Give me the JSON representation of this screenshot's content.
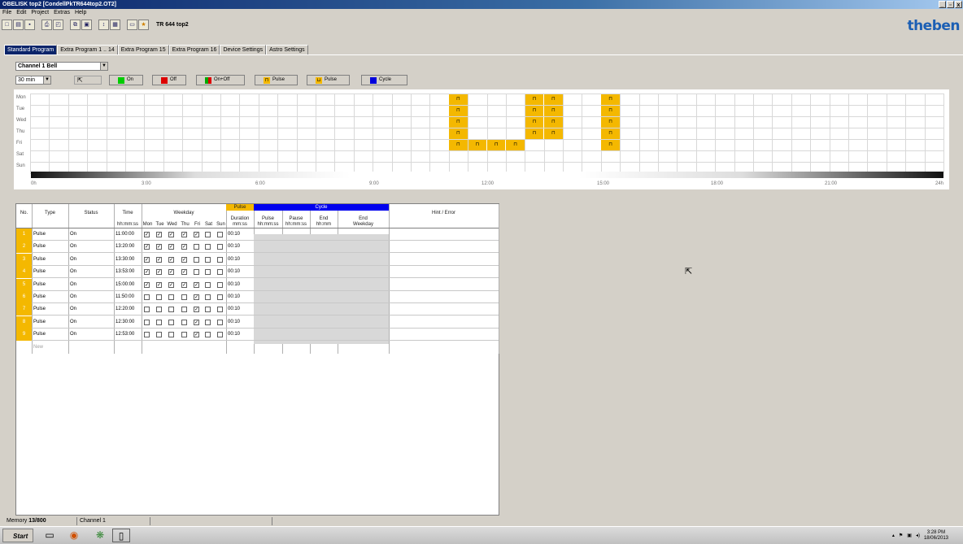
{
  "window": {
    "title": "OBELISK top2   [CondellPkTR644top2.OT2]",
    "controls": [
      "_",
      "▫",
      "x"
    ]
  },
  "menu": [
    "File",
    "Edit",
    "Project",
    "Extras",
    "Help"
  ],
  "toolbar": {
    "device_label": "TR 644 top2",
    "icons": [
      "new-file-icon",
      "open-icon",
      "save-icon",
      "print-icon",
      "print-preview-icon",
      "copy-icon",
      "paste-icon",
      "sort-icon",
      "import-icon",
      "display-icon",
      "program-icon"
    ]
  },
  "brand": "theben",
  "tabs": [
    "Standard Program",
    "Extra Program 1 .. 14",
    "Extra Program 15",
    "Extra Program 16",
    "Device Settings",
    "Astro Settings"
  ],
  "active_tab": 0,
  "channel": {
    "selected": "Channel 1 Bell",
    "interval": "30 min"
  },
  "modes": [
    {
      "label": "On",
      "color": "#00cc00"
    },
    {
      "label": "Off",
      "color": "#dd0000"
    },
    {
      "label": "On+Off",
      "color": "#00aa00",
      "color2": "#dd0000"
    },
    {
      "label": "Pulse",
      "color": "#f4b800"
    },
    {
      "label": "Pulse",
      "color": "#f4b800"
    },
    {
      "label": "Cycle",
      "color": "#0000dd"
    }
  ],
  "grid": {
    "days": [
      "Mon",
      "Tue",
      "Wed",
      "Thu",
      "Fri",
      "Sat",
      "Sun"
    ],
    "hour_labels": [
      "0h",
      "3:00",
      "6:00",
      "9:00",
      "12:00",
      "15:00",
      "18:00",
      "21:00",
      "24h"
    ],
    "pulse_color": "#f4b800",
    "block_color": "#000000"
  },
  "table": {
    "headers": {
      "no": "No.",
      "type": "Type",
      "status": "Status",
      "time": "Time",
      "time_unit": "hh:mm:ss",
      "weekday": "Weekday",
      "weekdays": [
        "Mon",
        "Tue",
        "Wed",
        "Thu",
        "Fri",
        "Sat",
        "Sun"
      ],
      "pulse": "Pulse",
      "duration": "Duration",
      "duration_unit": "mm:ss",
      "cycle": "Cycle",
      "cycle_pulse": "Pulse",
      "cycle_pulse_unit": "hh:mm:ss",
      "cycle_pause": "Pause",
      "cycle_pause_unit": "hh:mm:ss",
      "cycle_end": "End",
      "cycle_end_unit": "hh:mm",
      "cycle_end_weekday": "End",
      "cycle_end_weekday_unit": "Weekday",
      "hint": "Hint / Error"
    },
    "rows": [
      {
        "no": "1",
        "type": "Pulse",
        "status": "On",
        "time": "11:00:00",
        "days": [
          1,
          1,
          1,
          1,
          1,
          0,
          0
        ],
        "duration": "00:10"
      },
      {
        "no": "2",
        "type": "Pulse",
        "status": "On",
        "time": "13:20:00",
        "days": [
          1,
          1,
          1,
          1,
          0,
          0,
          0
        ],
        "duration": "00:10"
      },
      {
        "no": "3",
        "type": "Pulse",
        "status": "On",
        "time": "13:30:00",
        "days": [
          1,
          1,
          1,
          1,
          0,
          0,
          0
        ],
        "duration": "00:10"
      },
      {
        "no": "4",
        "type": "Pulse",
        "status": "On",
        "time": "13:53:00",
        "days": [
          1,
          1,
          1,
          1,
          0,
          0,
          0
        ],
        "duration": "00:10"
      },
      {
        "no": "5",
        "type": "Pulse",
        "status": "On",
        "time": "15:00:00",
        "days": [
          1,
          1,
          1,
          1,
          1,
          0,
          0
        ],
        "duration": "00:10"
      },
      {
        "no": "6",
        "type": "Pulse",
        "status": "On",
        "time": "11:50:00",
        "days": [
          0,
          0,
          0,
          0,
          1,
          0,
          0
        ],
        "duration": "00:10"
      },
      {
        "no": "7",
        "type": "Pulse",
        "status": "On",
        "time": "12:20:00",
        "days": [
          0,
          0,
          0,
          0,
          1,
          0,
          0
        ],
        "duration": "00:10"
      },
      {
        "no": "8",
        "type": "Pulse",
        "status": "On",
        "time": "12:30:00",
        "days": [
          0,
          0,
          0,
          0,
          1,
          0,
          0
        ],
        "duration": "00:10"
      },
      {
        "no": "9",
        "type": "Pulse",
        "status": "On",
        "time": "12:53:00",
        "days": [
          0,
          0,
          0,
          0,
          1,
          0,
          0
        ],
        "duration": "00:10"
      }
    ],
    "new_row_label": "New"
  },
  "statusbar": {
    "memory_label": "Memory",
    "memory_value": "13/800",
    "channel": "Channel 1"
  },
  "taskbar": {
    "start": "Start",
    "clock_time": "3:28 PM",
    "clock_date": "18/06/2013"
  }
}
